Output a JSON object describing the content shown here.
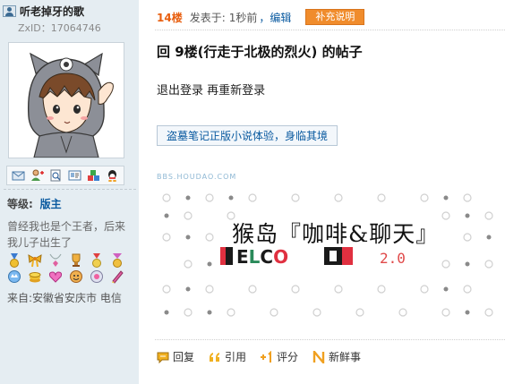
{
  "sidebar": {
    "username": "听老掉牙的歌",
    "zxid": "ZxID：17064746",
    "toolbar_icons": [
      "email-icon",
      "add-friend-icon",
      "search-posts-icon",
      "profile-card-icon",
      "blocks-icon",
      "qq-icon"
    ],
    "rank_label": "等级:",
    "rank_value": "版主",
    "signature": "曾经我也是个王者，后来我儿子出生了",
    "medals": [
      "medal-blue-ribbon-icon",
      "medal-bow-icon",
      "medal-necklace-icon",
      "medal-trophy-icon",
      "medal-gift-icon",
      "medal-badge-icon",
      "medal-crown-icon",
      "medal-coin-icon",
      "medal-heart-icon",
      "medal-face-icon",
      "medal-orb-icon",
      "medal-pen-icon"
    ],
    "location": "来自:安徽省安庆市 电信"
  },
  "post": {
    "floor": "14楼",
    "posted_label": "发表于:",
    "posted_time": "1秒前",
    "edit_label": "，编辑",
    "supplement_button": "补充说明",
    "title": "回 9楼(行走于北极的烈火) 的帖子",
    "action_text": "退出登录 再重新登录",
    "promo_link": "盗墓笔记正版小说体验，身临其境",
    "watermark": "BBS.HOUDAO.COM",
    "banner_title": "猴岛『咖啡&聊天』",
    "banner_version": "2.0",
    "banner_logo_letters": [
      "E",
      "L",
      "C",
      "O"
    ]
  },
  "actions": {
    "reply": "回复",
    "quote": "引用",
    "rate": "评分",
    "news": "新鲜事"
  },
  "colors": {
    "sidebar_bg": "#e5edf2",
    "floor": "#e85e0e",
    "link": "#0a5aa0",
    "button": "#f08c2c"
  }
}
